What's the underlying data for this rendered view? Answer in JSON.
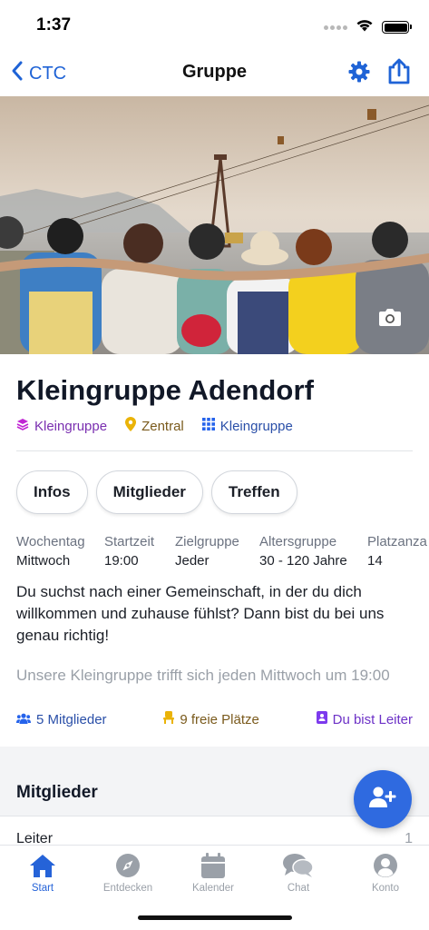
{
  "status_bar": {
    "time": "1:37"
  },
  "nav": {
    "back_label": "CTC",
    "title": "Gruppe",
    "icons": [
      "chevron-left-icon",
      "gear-icon",
      "share-icon"
    ]
  },
  "hero": {
    "camera_icon": "camera-icon"
  },
  "group": {
    "title": "Kleingruppe Adendorf",
    "tags": [
      {
        "icon": "layers-icon",
        "label": "Kleingruppe",
        "color": "#c026d3"
      },
      {
        "icon": "map-pin-icon",
        "label": "Zentral",
        "color": "#eab308"
      },
      {
        "icon": "grid-icon",
        "label": "Kleingruppe",
        "color": "#2563eb"
      }
    ]
  },
  "tabs": [
    {
      "label": "Infos"
    },
    {
      "label": "Mitglieder"
    },
    {
      "label": "Treffen"
    }
  ],
  "info": [
    {
      "label": "Wochentag",
      "value": "Mittwoch"
    },
    {
      "label": "Startzeit",
      "value": "19:00"
    },
    {
      "label": "Zielgruppe",
      "value": "Jeder"
    },
    {
      "label": "Altersgruppe",
      "value": "30 - 120 Jahre"
    },
    {
      "label": "Platzanza",
      "value": "14"
    }
  ],
  "description": {
    "text": "Du suchst nach einer Gemeinschaft, in der du dich willkommen und zuhause fühlst? Dann bist du bei uns genau richtig!",
    "more": "Unsere Kleingruppe trifft sich jeden Mittwoch um 19:00"
  },
  "stats": {
    "members": "5 Mitglieder",
    "places": "9 freie Plätze",
    "leader": "Du bist Leiter"
  },
  "members_section": {
    "title": "Mitglieder",
    "leader_label": "Leiter",
    "leader_count": "1"
  },
  "tab_bar": [
    {
      "label": "Start",
      "icon": "home-icon",
      "active": true
    },
    {
      "label": "Entdecken",
      "icon": "compass-icon",
      "active": false
    },
    {
      "label": "Kalender",
      "icon": "calendar-icon",
      "active": false
    },
    {
      "label": "Chat",
      "icon": "chat-icon",
      "active": false
    },
    {
      "label": "Konto",
      "icon": "user-circle-icon",
      "active": false
    }
  ],
  "colors": {
    "accent": "#2563d8",
    "fab": "#2f6ae0"
  }
}
